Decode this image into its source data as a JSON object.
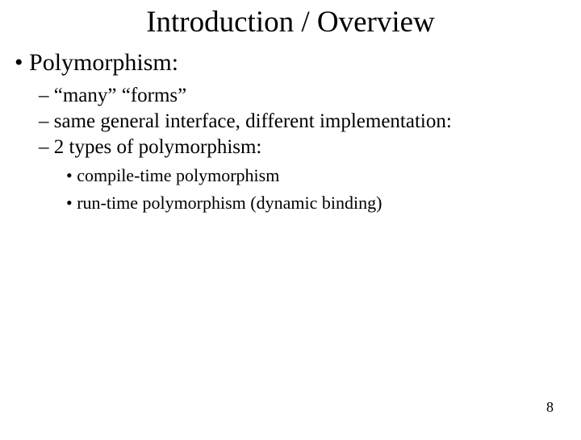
{
  "title": "Introduction / Overview",
  "level1": {
    "item0": "Polymorphism:"
  },
  "level2": {
    "item0": "“many” “forms”",
    "item1": "same general interface, different implementation:",
    "item2": "2 types of polymorphism:"
  },
  "level3": {
    "item0": "compile-time polymorphism",
    "item1": "run-time polymorphism (dynamic binding)"
  },
  "page_number": "8"
}
